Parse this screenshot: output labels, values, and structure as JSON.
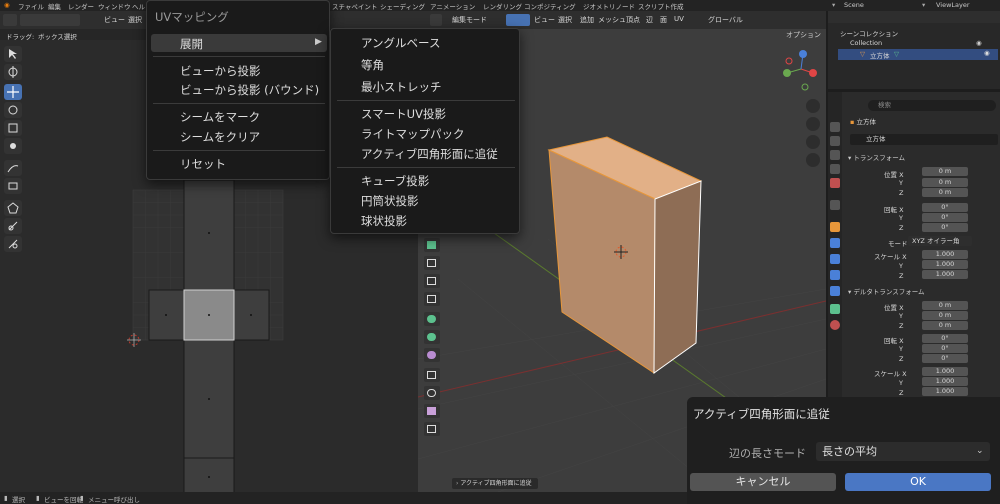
{
  "top_menu": {
    "file": "ファイル",
    "edit": "編集",
    "render": "レンダー",
    "window": "ウィンドウ",
    "help": "ヘル",
    "workspaces": [
      "スチャペイント",
      "シェーディング",
      "アニメーション",
      "レンダリング",
      "コンポジティング",
      "ジオメトリノード",
      "スクリプト作成"
    ],
    "scene": "Scene",
    "view_layer": "ViewLayer"
  },
  "uv_editor": {
    "header": {
      "view": "ビュー",
      "select": "選択"
    },
    "subheader": {
      "drag_label": "ドラッグ:",
      "drag_mode": "ボックス選択"
    }
  },
  "viewport": {
    "header": {
      "mode": "編集モード",
      "view": "ビュー",
      "select": "選択",
      "add": "追加",
      "mesh": "メッシュ",
      "vertex": "頂点",
      "edge": "辺",
      "face": "面",
      "uv": "UV",
      "orientation": "グローバル"
    },
    "options": "オプション",
    "last_op": "アクティブ四角形面に追従"
  },
  "uv_menu": {
    "title": "UVマッピング",
    "items": [
      "展開",
      "ビューから投影",
      "ビューから投影 (バウンド)",
      "シームをマーク",
      "シームをクリア",
      "リセット"
    ]
  },
  "unwrap_submenu": {
    "items": [
      "アングルベース",
      "等角",
      "最小ストレッチ",
      "スマートUV投影",
      "ライトマップパック",
      "アクティブ四角形面に追従",
      "キューブ投影",
      "円筒状投影",
      "球状投影"
    ]
  },
  "outliner": {
    "scene_collection": "シーンコレクション",
    "collection": "Collection",
    "object": "立方体"
  },
  "properties": {
    "search_placeholder": "検索",
    "object_name": "立方体",
    "object_data": "立方体",
    "transform_title": "トランスフォーム",
    "location": {
      "label": "位置 X",
      "x": "0 m",
      "y": "0 m",
      "z": "0 m"
    },
    "rotation": {
      "label": "回転 X",
      "x": "0°",
      "y": "0°",
      "z": "0°"
    },
    "mode_label": "モード",
    "mode_value": "XYZ オイラー角",
    "scale": {
      "label": "スケール X",
      "x": "1.000",
      "y": "1.000",
      "z": "1.000"
    },
    "delta_title": "デルタトランスフォーム",
    "delta_location": {
      "label": "位置 X",
      "x": "0 m",
      "y": "0 m",
      "z": "0 m"
    },
    "delta_rotation": {
      "label": "回転 X",
      "x": "0°",
      "y": "0°",
      "z": "0°"
    },
    "delta_scale": {
      "label": "スケール X",
      "x": "1.000",
      "y": "1.000",
      "z": "1.000"
    },
    "axis_y": "Y",
    "axis_z": "Z"
  },
  "operator_panel": {
    "title": "アクティブ四角形面に追従",
    "edge_length_label": "辺の長さモード",
    "edge_length_value": "長さの平均",
    "cancel": "キャンセル",
    "ok": "OK"
  },
  "status_bar": {
    "select": "選択",
    "rotate_view": "ビューを回転",
    "menu": "メニュー呼び出し"
  },
  "colors": {
    "accent": "#4772b3",
    "ok_button": "#4a77c4",
    "selection_orange": "#e8973a",
    "menu_bg": "#1a1a1a"
  }
}
